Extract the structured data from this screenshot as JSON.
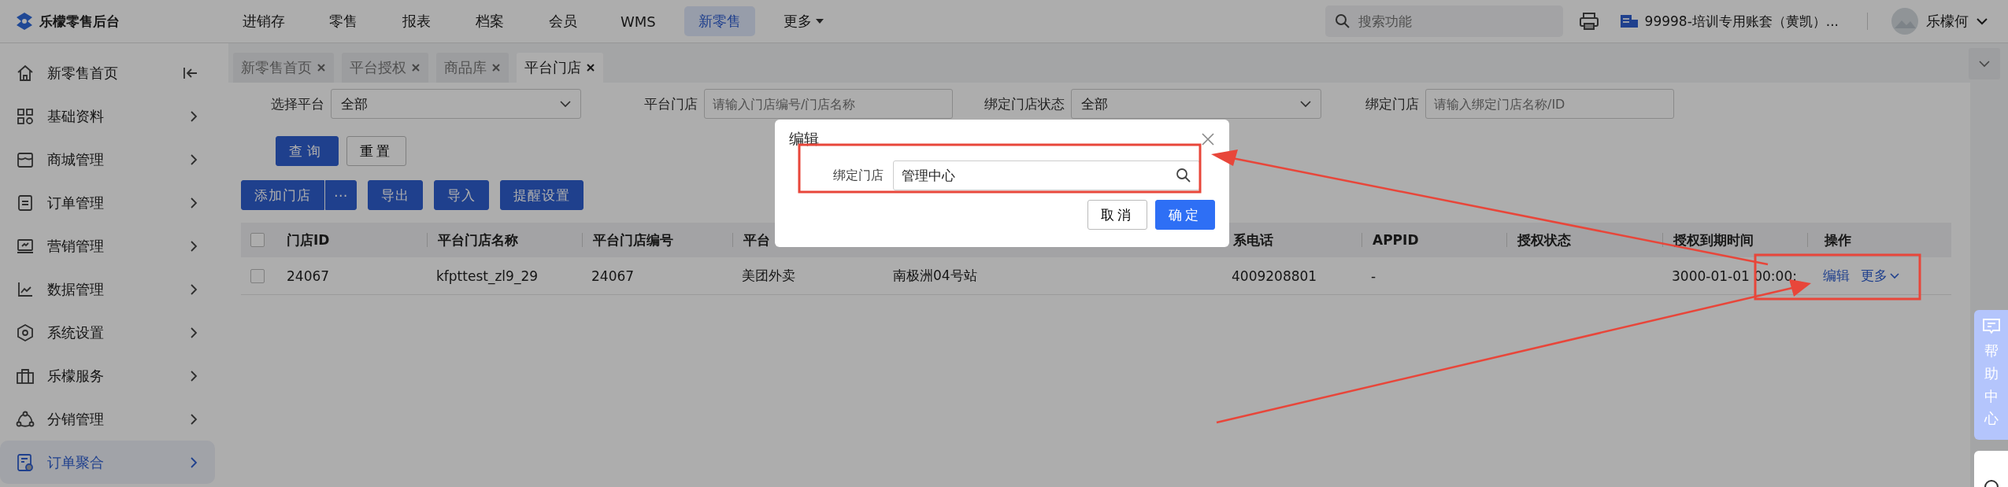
{
  "app": {
    "title": "乐檬零售后台"
  },
  "top_nav": [
    {
      "label": "进销存",
      "selected": false
    },
    {
      "label": "零售",
      "selected": false
    },
    {
      "label": "报表",
      "selected": false
    },
    {
      "label": "档案",
      "selected": false
    },
    {
      "label": "会员",
      "selected": false
    },
    {
      "label": "WMS",
      "selected": false
    },
    {
      "label": "新零售",
      "selected": true
    },
    {
      "label": "更多",
      "selected": false,
      "kind": "dropdown"
    }
  ],
  "search": {
    "placeholder": "搜索功能"
  },
  "account": {
    "label": "99998-培训专用账套（黄凯）..."
  },
  "user": {
    "name": "乐檬何"
  },
  "sidebar": {
    "items": [
      {
        "label": "新零售首页",
        "selected": false
      },
      {
        "label": "基础资料",
        "selected": false
      },
      {
        "label": "商城管理",
        "selected": false
      },
      {
        "label": "订单管理",
        "selected": false
      },
      {
        "label": "营销管理",
        "selected": false
      },
      {
        "label": "数据管理",
        "selected": false
      },
      {
        "label": "系统设置",
        "selected": false
      },
      {
        "label": "乐檬服务",
        "selected": false
      },
      {
        "label": "分销管理",
        "selected": false
      },
      {
        "label": "订单聚合",
        "selected": true
      }
    ]
  },
  "tabs": [
    {
      "label": "新零售首页",
      "selected": false
    },
    {
      "label": "平台授权",
      "selected": false
    },
    {
      "label": "商品库",
      "selected": false
    },
    {
      "label": "平台门店",
      "selected": true
    }
  ],
  "filters": [
    {
      "label": "选择平台",
      "kind": "select",
      "value": "全部"
    },
    {
      "label": "平台门店",
      "kind": "input",
      "placeholder": "请输入门店编号/门店名称"
    },
    {
      "label": "绑定门店状态",
      "kind": "select",
      "value": "全部"
    },
    {
      "label": "绑定门店",
      "kind": "input",
      "placeholder": "请输入绑定门店名称/ID"
    }
  ],
  "filter_buttons": [
    {
      "label": "查询",
      "kind": "primary"
    },
    {
      "label": "重置",
      "kind": "default"
    }
  ],
  "toolbar": [
    {
      "label": "添加门店",
      "kind": "split",
      "more": "⋯"
    },
    {
      "label": "导出",
      "kind": "plain"
    },
    {
      "label": "导入",
      "kind": "plain"
    },
    {
      "label": "提醒设置",
      "kind": "plain"
    }
  ],
  "table": {
    "header_checked": false,
    "columns": [
      {
        "label": "门店ID"
      },
      {
        "label": "平台门店名称"
      },
      {
        "label": "平台门店编号"
      },
      {
        "label": "平台"
      },
      {
        "label": "系电话"
      },
      {
        "label": "APPID"
      },
      {
        "label": "授权状态"
      },
      {
        "label": "授权到期时间"
      },
      {
        "label": "操作"
      }
    ],
    "rows": [
      {
        "checked": false,
        "store_id": "24067",
        "platform_store_name": "kfpttest_zl9_29",
        "platform_store_no": "24067",
        "platform": "美团外卖",
        "column_5": "南极洲04号站",
        "phone": "4009208801",
        "appid": "-",
        "auth_expiry": "3000-01-01 00:00:",
        "actions": [
          {
            "label": "编辑",
            "kind": "link"
          },
          {
            "label": "更多",
            "kind": "dropdown"
          }
        ]
      }
    ]
  },
  "modal": {
    "title": "编辑",
    "field": {
      "label": "绑定门店",
      "value": "管理中心"
    },
    "buttons": [
      {
        "label": "取消",
        "kind": "default"
      },
      {
        "label": "确定",
        "kind": "primary"
      }
    ]
  },
  "help": {
    "label": "帮助中心"
  }
}
